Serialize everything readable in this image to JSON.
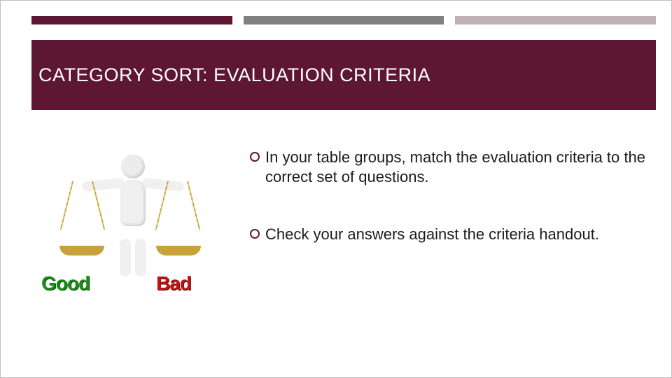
{
  "title": "CATEGORY SORT: EVALUATION CRITERIA",
  "bullets": {
    "b1": "In your table groups, match the evaluation criteria to the correct set of questions.",
    "b2": "Check your answers against the criteria handout."
  },
  "illustration": {
    "good_label": "Good",
    "bad_label": "Bad"
  }
}
